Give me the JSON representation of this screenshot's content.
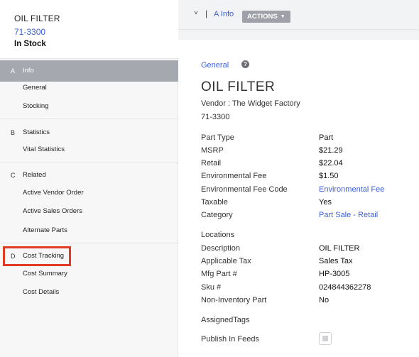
{
  "sidebar": {
    "title": "OIL FILTER",
    "part_number": "71-3300",
    "stock_status": "In Stock",
    "sections": [
      {
        "letter": "A",
        "label": "Info",
        "items": [
          "General",
          "Stocking"
        ]
      },
      {
        "letter": "B",
        "label": "Statistics",
        "items": [
          "Vital Statistics"
        ]
      },
      {
        "letter": "C",
        "label": "Related",
        "items": [
          "Active Vendor Order",
          "Active Sales Orders",
          "Alternate Parts"
        ]
      },
      {
        "letter": "D",
        "label": "Cost Tracking",
        "items": [
          "Cost Summary",
          "Cost Details"
        ]
      }
    ]
  },
  "topbar": {
    "chevron": "˅",
    "separator": "|",
    "title": "A Info",
    "actions_label": "ACTIONS"
  },
  "main": {
    "section_link": "General",
    "help": "?",
    "part_title": "OIL FILTER",
    "vendor": "Vendor : The Widget Factory",
    "part_number": "71-3300",
    "fields": [
      {
        "label": "Part Type",
        "value": "Part"
      },
      {
        "label": "MSRP",
        "value": "$21.29"
      },
      {
        "label": "Retail",
        "value": "$22.04"
      },
      {
        "label": "Environmental Fee",
        "value": "$1.50"
      },
      {
        "label": "Environmental Fee Code",
        "value": "Environmental Fee"
      },
      {
        "label": "Taxable",
        "value": "Yes"
      },
      {
        "label": "Category",
        "value": "Part Sale - Retail"
      }
    ],
    "locations_label": "Locations",
    "fields2": [
      {
        "label": "Description",
        "value": "OIL FILTER"
      },
      {
        "label": "Applicable Tax",
        "value": "Sales Tax"
      },
      {
        "label": "Mfg Part #",
        "value": "HP-3005"
      },
      {
        "label": "Sku #",
        "value": "024844362278"
      },
      {
        "label": "Non-Inventory Part",
        "value": "No"
      }
    ],
    "assigned_tags_label": "AssignedTags",
    "publish_label": "Publish In Feeds"
  },
  "colors": {
    "accent": "#3d5fd6",
    "active_section": "#a5a8af",
    "highlight": "#e03c24"
  }
}
